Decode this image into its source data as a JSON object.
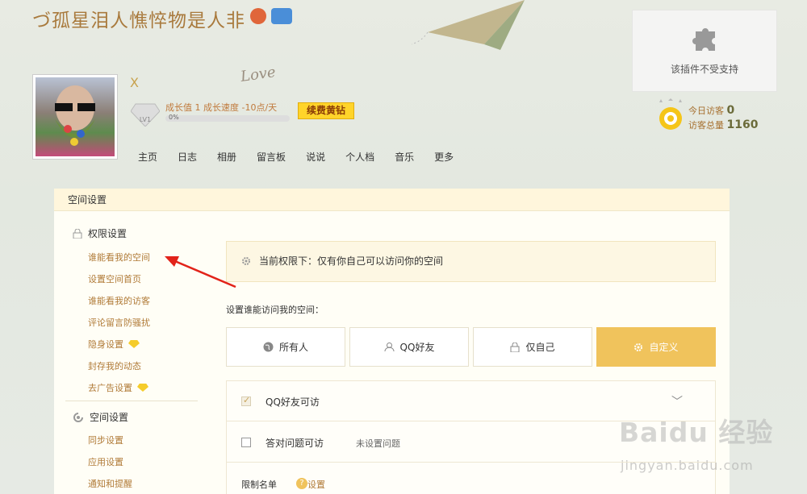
{
  "header": {
    "blog_title": "づ孤星泪人憔悴物是人非",
    "username": "X",
    "level": "LV1",
    "growth": "成长值 1   成长速度 -10点/天",
    "growth_pct": "0%",
    "growth_progress": 0,
    "renew_label": "续费黄钻",
    "love_text": "Love",
    "plugin_text": "该插件不受支持",
    "visitors_today_label": "今日访客",
    "visitors_today": "0",
    "visitors_total_label": "访客总量",
    "visitors_total": "1160"
  },
  "nav": [
    "主页",
    "日志",
    "相册",
    "留言板",
    "说说",
    "个人档",
    "音乐",
    "更多"
  ],
  "panel": {
    "title": "空间设置",
    "groups": [
      {
        "label": "权限设置",
        "icon": "lock-icon"
      },
      {
        "label": "空间设置",
        "icon": "settings-icon"
      }
    ],
    "perm_items": [
      "谁能看我的空间",
      "设置空间首页",
      "谁能看我的访客",
      "评论留言防骚扰",
      "隐身设置",
      "封存我的动态",
      "去广告设置"
    ],
    "space_items": [
      "同步设置",
      "应用设置",
      "通知和提醒"
    ],
    "notice": "当前权限下：仅有你自己可以访问你的空间",
    "set_label": "设置谁能访问我的空间：",
    "options": [
      "所有人",
      "QQ好友",
      "仅自己",
      "自定义"
    ],
    "selected_option": "自定义",
    "checks": {
      "qq_friends": "QQ好友可访",
      "answer_q": "答对问题可访",
      "no_question": "未设置问题",
      "limit_list": "限制名单",
      "set_link": "设置"
    }
  },
  "watermark": {
    "brand": "Baidu 经验",
    "url": "jingyan.baidu.com"
  },
  "colors": {
    "accent": "#f0c35c",
    "link": "#b07a37",
    "title": "#a97a3d"
  }
}
